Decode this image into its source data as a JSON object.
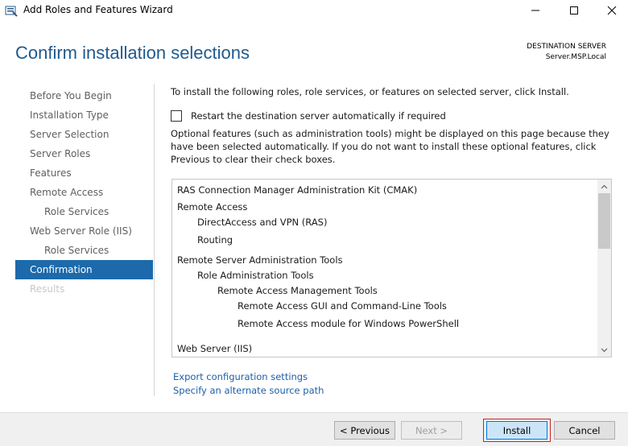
{
  "window": {
    "title": "Add Roles and Features Wizard"
  },
  "header": {
    "page_title": "Confirm installation selections",
    "destination_label": "DESTINATION SERVER",
    "destination_server": "Server.MSP.Local"
  },
  "nav": {
    "items": [
      {
        "label": "Before You Begin"
      },
      {
        "label": "Installation Type"
      },
      {
        "label": "Server Selection"
      },
      {
        "label": "Server Roles"
      },
      {
        "label": "Features"
      },
      {
        "label": "Remote Access"
      },
      {
        "label": "Role Services"
      },
      {
        "label": "Web Server Role (IIS)"
      },
      {
        "label": "Role Services"
      },
      {
        "label": "Confirmation"
      },
      {
        "label": "Results"
      }
    ]
  },
  "content": {
    "intro": "To install the following roles, role services, or features on selected server, click Install.",
    "restart_label": "Restart the destination server automatically if required",
    "optional_text": "Optional features (such as administration tools) might be displayed on this page because they have been selected automatically. If you do not want to install these optional features, click Previous to clear their check boxes.",
    "selections": [
      {
        "label": "RAS Connection Manager Administration Kit (CMAK)"
      },
      {
        "label": "Remote Access"
      },
      {
        "label": "DirectAccess and VPN (RAS)"
      },
      {
        "label": "Routing"
      },
      {
        "label": "Remote Server Administration Tools"
      },
      {
        "label": "Role Administration Tools"
      },
      {
        "label": "Remote Access Management Tools"
      },
      {
        "label": "Remote Access GUI and Command-Line Tools"
      },
      {
        "label": "Remote Access module for Windows PowerShell"
      },
      {
        "label": "Web Server (IIS)"
      }
    ],
    "export_link": "Export configuration settings",
    "alternate_link": "Specify an alternate source path"
  },
  "footer": {
    "previous_label": "< Previous",
    "next_label": "Next >",
    "install_label": "Install",
    "cancel_label": "Cancel"
  },
  "colors": {
    "accent": "#1c6aab",
    "title": "#1f5a8e",
    "link": "#1c5fa8",
    "highlight_border": "#c6242b"
  }
}
